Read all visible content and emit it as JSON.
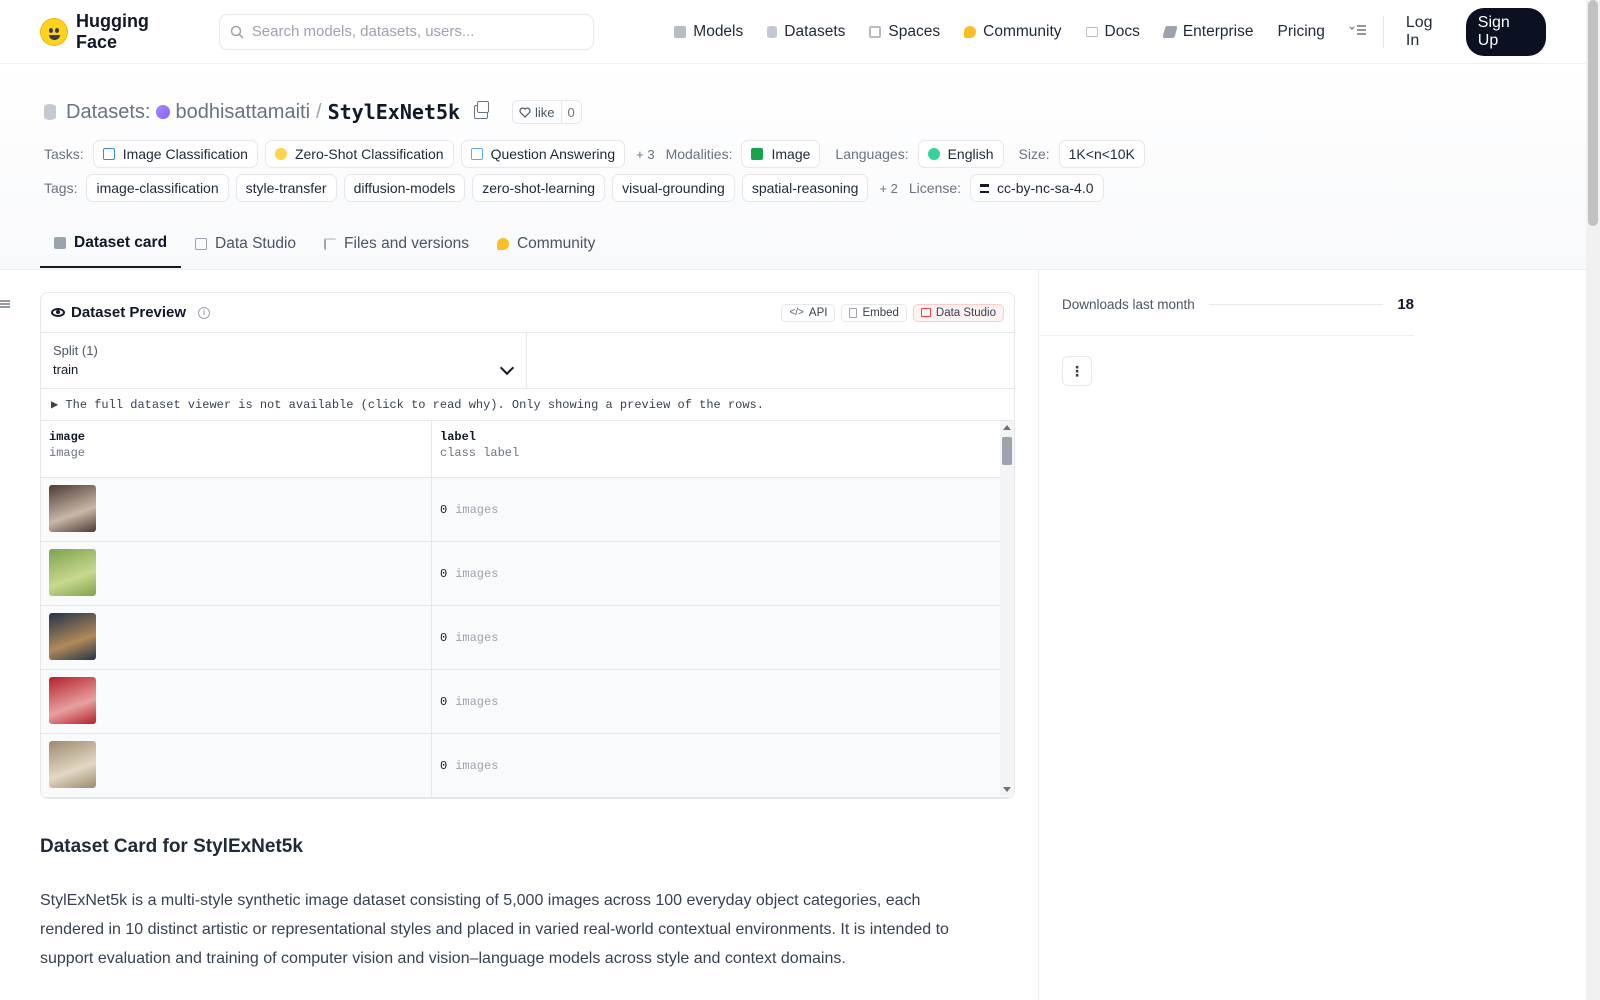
{
  "header": {
    "brand": "Hugging Face",
    "search_placeholder": "Search models, datasets, users...",
    "nav": [
      {
        "label": "Models",
        "icon": "cube-icon",
        "color": "#9ca3af"
      },
      {
        "label": "Datasets",
        "icon": "database-icon",
        "color": "#9ca3af"
      },
      {
        "label": "Spaces",
        "icon": "grid-icon",
        "color": "#9ca3af"
      },
      {
        "label": "Community",
        "icon": "community-icon",
        "color": "#fbbf24"
      },
      {
        "label": "Docs",
        "icon": "book-icon",
        "color": "#9ca3af"
      },
      {
        "label": "Enterprise",
        "icon": "enterprise-icon",
        "color": "#6b7280"
      },
      {
        "label": "Pricing",
        "icon": "",
        "color": ""
      }
    ],
    "login": "Log In",
    "signup": "Sign Up"
  },
  "dataset": {
    "section": "Datasets:",
    "owner": "bodhisattamaiti",
    "separator": "/",
    "name": "StylExNet5k",
    "like_label": "like",
    "like_count": "0",
    "tasks_label": "Tasks:",
    "tasks": [
      {
        "label": "Image Classification",
        "color": "#dbeafe"
      },
      {
        "label": "Zero-Shot Classification",
        "color": "#fef3c7"
      },
      {
        "label": "Question Answering",
        "color": "#dbeafe"
      }
    ],
    "tasks_more": "+ 3",
    "modalities_label": "Modalities:",
    "modalities": [
      {
        "label": "Image",
        "color": "#16a34a"
      }
    ],
    "languages_label": "Languages:",
    "languages": [
      {
        "label": "English",
        "color": "#10b981"
      }
    ],
    "size_label": "Size:",
    "size": "1K<n<10K",
    "tags_label": "Tags:",
    "tags": [
      "image-classification",
      "style-transfer",
      "diffusion-models",
      "zero-shot-learning",
      "visual-grounding",
      "spatial-reasoning"
    ],
    "tags_more": "+ 2",
    "license_label": "License:",
    "license": "cc-by-nc-sa-4.0"
  },
  "tabs": [
    {
      "label": "Dataset card",
      "active": true
    },
    {
      "label": "Data Studio",
      "active": false
    },
    {
      "label": "Files and versions",
      "active": false
    },
    {
      "label": "Community",
      "active": false
    }
  ],
  "preview": {
    "title": "Dataset Preview",
    "buttons": {
      "api": "API",
      "embed": "Embed",
      "studio": "Data Studio"
    },
    "split_label": "Split (1)",
    "split_value": "train",
    "note": "▶ The full dataset viewer is not available (click to read why). Only showing a preview of the rows.",
    "columns": [
      {
        "name": "image",
        "type": "image"
      },
      {
        "name": "label",
        "type": "class label"
      }
    ],
    "rows": [
      {
        "label_value": "0",
        "label_text": "images",
        "thumb_colors": [
          "#4a3a33",
          "#c9b8a8"
        ]
      },
      {
        "label_value": "0",
        "label_text": "images",
        "thumb_colors": [
          "#7ea34c",
          "#c8d88f"
        ]
      },
      {
        "label_value": "0",
        "label_text": "images",
        "thumb_colors": [
          "#243347",
          "#b08a5a"
        ]
      },
      {
        "label_value": "0",
        "label_text": "images",
        "thumb_colors": [
          "#b3212a",
          "#e8a0a0"
        ]
      },
      {
        "label_value": "0",
        "label_text": "images",
        "thumb_colors": [
          "#9c8a6e",
          "#e3d8c4"
        ]
      }
    ]
  },
  "card": {
    "title": "Dataset Card for StylExNet5k",
    "text": "StylExNet5k is a multi-style synthetic image dataset consisting of 5,000 images across 100 everyday object categories, each rendered in 10 distinct artistic or representational styles and placed in varied real-world contextual environments. It is intended to support evaluation and training of computer vision and vision–language models across style and context domains."
  },
  "sidebar": {
    "downloads_label": "Downloads last month",
    "downloads_value": "18",
    "menu_icon": "⋮"
  }
}
